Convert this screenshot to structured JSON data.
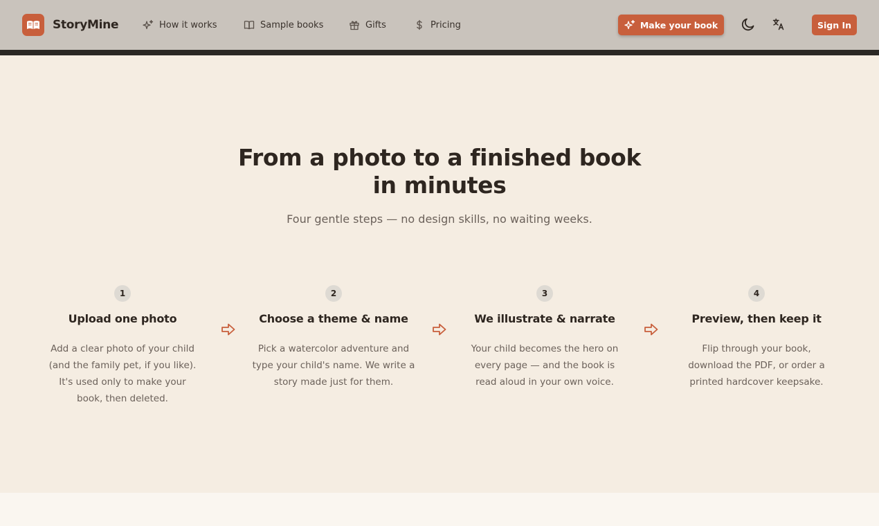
{
  "brand": {
    "name": "StoryMine",
    "accent": "#c85f3c"
  },
  "nav": {
    "links": [
      {
        "label": "How it works",
        "icon": "sparkles-icon"
      },
      {
        "label": "Sample books",
        "icon": "open-book-icon"
      },
      {
        "label": "Gifts",
        "icon": "gift-icon"
      },
      {
        "label": "Pricing",
        "icon": "dollar-icon"
      }
    ],
    "cta_label": "Make your book",
    "signin_label": "Sign In",
    "theme_toggle_icon": "moon-icon",
    "language_icon": "translate-icon"
  },
  "hero": {
    "title": "From a photo to a finished book in minutes",
    "subtitle": "Four gentle steps — no design skills, no waiting weeks."
  },
  "steps": [
    {
      "number": "1",
      "title": "Upload one photo",
      "description": "Add a clear photo of your child (and the family pet, if you like). It's used only to make your book, then deleted."
    },
    {
      "number": "2",
      "title": "Choose a theme & name",
      "description": "Pick a watercolor adventure and type your child's name. We write a story made just for them."
    },
    {
      "number": "3",
      "title": "We illustrate & narrate",
      "description": "Your child becomes the hero on every page — and the book is read aloud in your own voice."
    },
    {
      "number": "4",
      "title": "Preview, then keep it",
      "description": "Flip through your book, download the PDF, or order a printed hardcover keepsake."
    }
  ]
}
